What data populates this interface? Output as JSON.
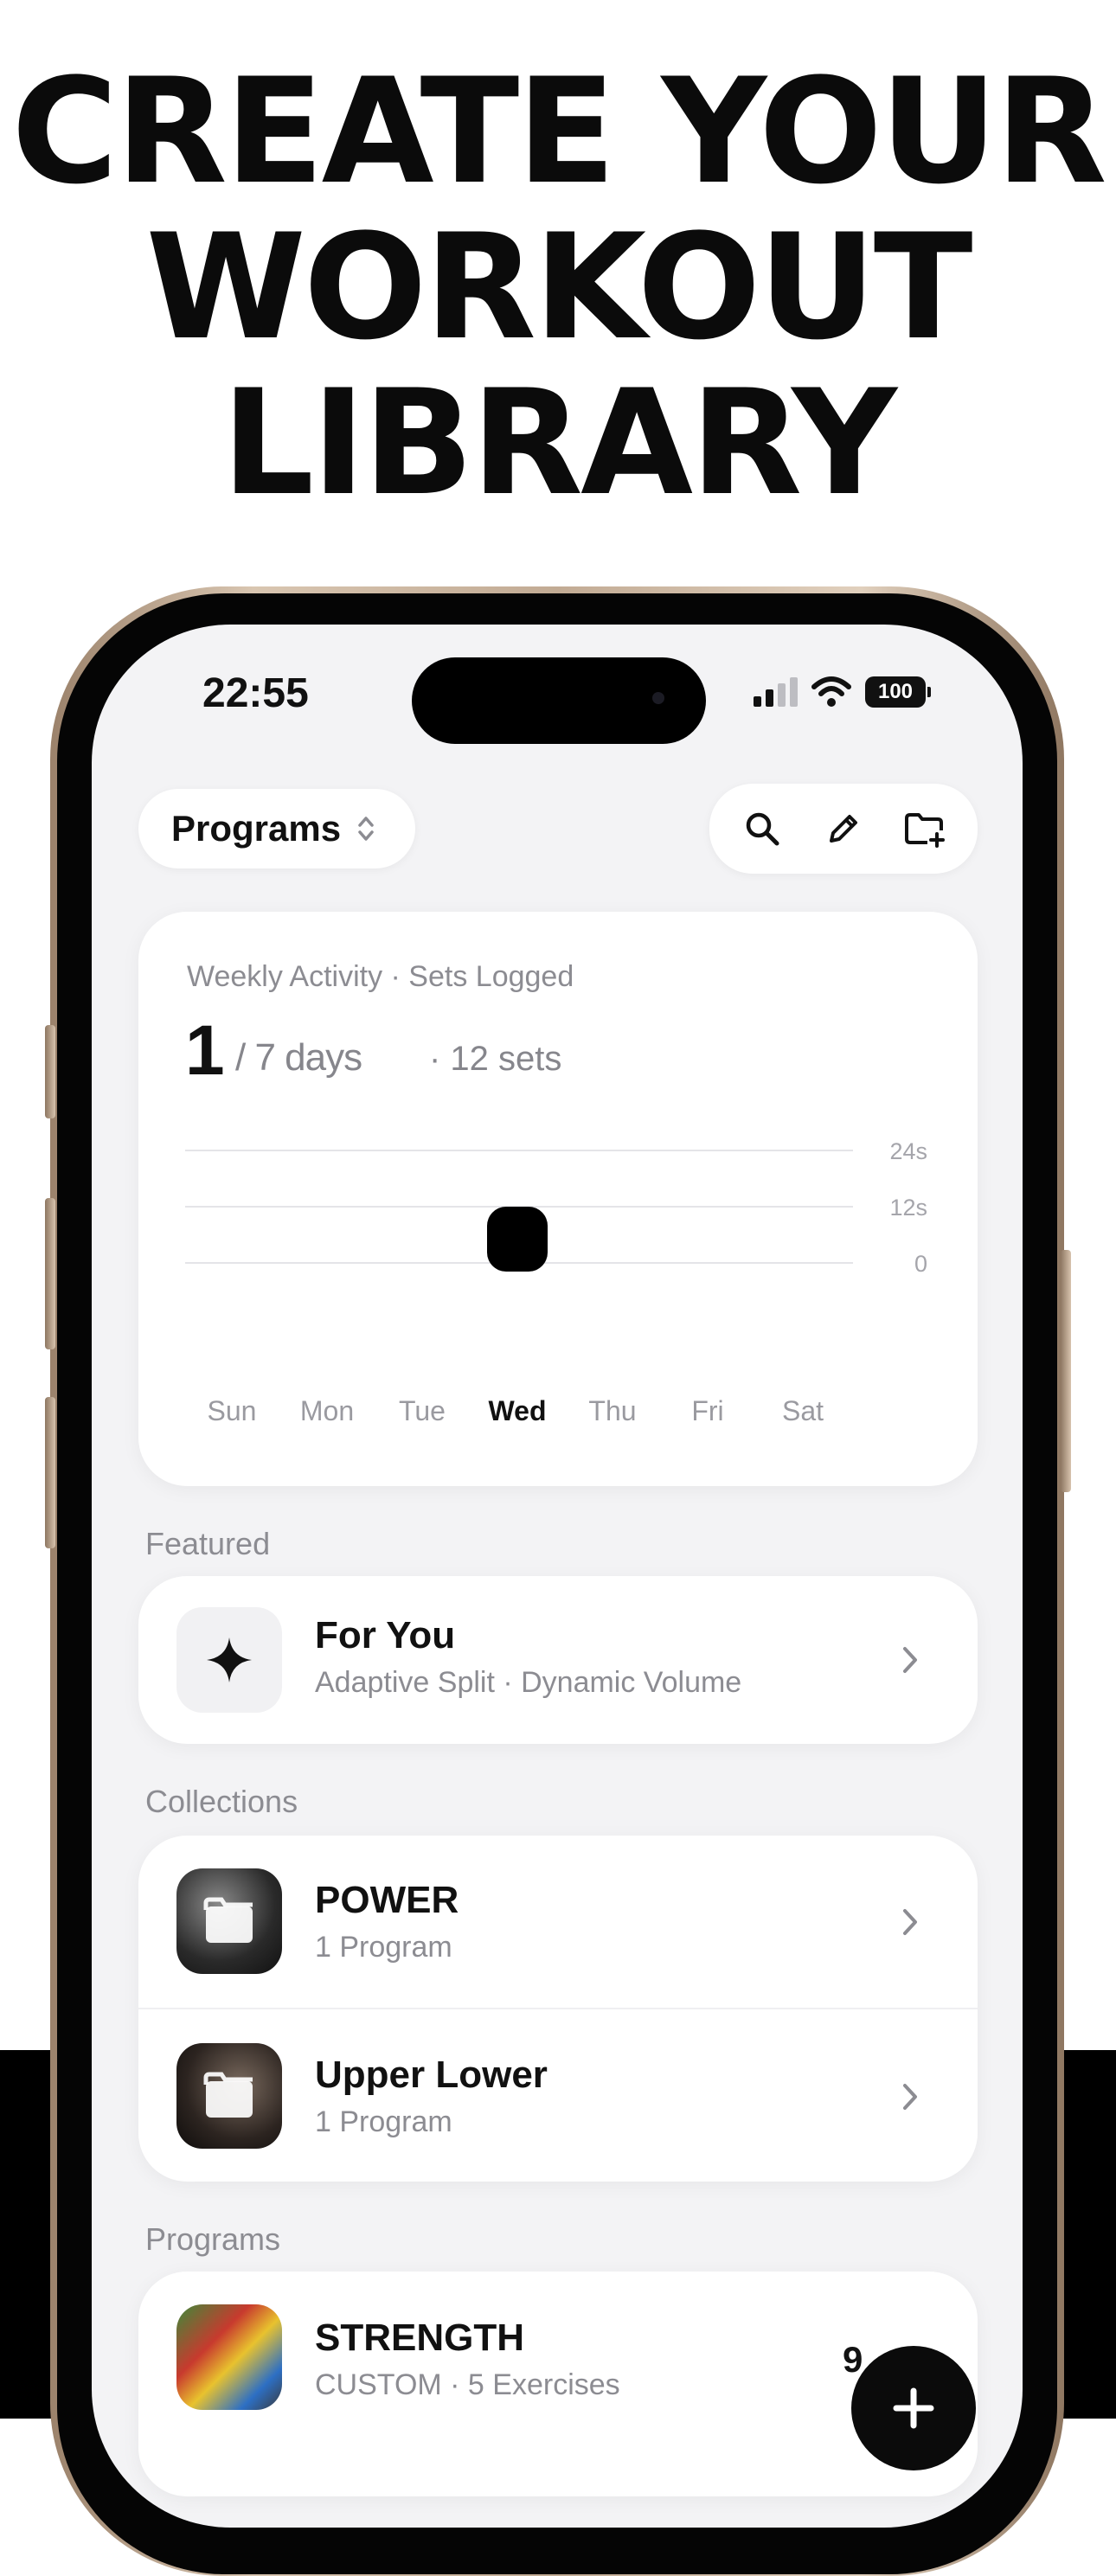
{
  "headline": {
    "line1": "CREATE YOUR",
    "line2": "WORKOUT",
    "line3": "LIBRARY"
  },
  "status_bar": {
    "time": "22:55",
    "battery": "100"
  },
  "toolbar": {
    "programs_label": "Programs",
    "icons": [
      "search-icon",
      "pencil-icon",
      "folder-plus-icon"
    ]
  },
  "activity": {
    "title": "Weekly Activity · Sets Logged",
    "days_logged": "1",
    "days_total": "/ 7 days",
    "sets_total": "· 12 sets"
  },
  "chart_data": {
    "type": "bar",
    "categories": [
      "Sun",
      "Mon",
      "Tue",
      "Wed",
      "Thu",
      "Fri",
      "Sat"
    ],
    "values": [
      0,
      0,
      0,
      12,
      0,
      0,
      0
    ],
    "highlight_category": "Wed",
    "y_ticks": [
      "0",
      "12s",
      "24s"
    ],
    "ylim": [
      0,
      24
    ],
    "grid": true,
    "bar_color": "#000000"
  },
  "featured": {
    "section_label": "Featured",
    "item": {
      "title": "For You",
      "subtitle": "Adaptive Split · Dynamic Volume",
      "icon": "sparkle-icon"
    }
  },
  "collections": {
    "section_label": "Collections",
    "items": [
      {
        "title": "POWER",
        "subtitle": "1 Program"
      },
      {
        "title": "Upper Lower",
        "subtitle": "1 Program"
      }
    ]
  },
  "programs": {
    "section_label": "Programs",
    "items": [
      {
        "title": "STRENGTH",
        "subtitle": "CUSTOM · 5 Exercises",
        "count": "9"
      }
    ]
  },
  "colors": {
    "accent": "#000000",
    "screen_bg": "#f3f3f5",
    "muted_text": "#8c8c92"
  }
}
